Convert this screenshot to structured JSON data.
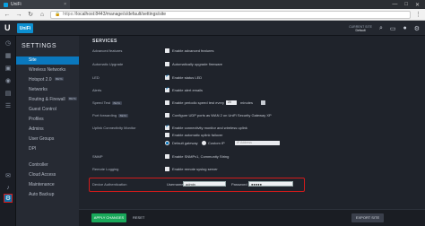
{
  "browser": {
    "tab_title": "UniFi",
    "tab_close": "×",
    "window_buttons": [
      "—",
      "□",
      "✕"
    ],
    "url_prefix": "https://",
    "url": "localhost:8443/manage/s/default/settings/site",
    "nav_icons": [
      "back-icon",
      "forward-icon",
      "reload-icon",
      "home-icon"
    ]
  },
  "header": {
    "logo_text": "U",
    "brand_text": "UniFi",
    "right_items": [
      "CURRENT SITE",
      "Default"
    ],
    "icons": [
      "search-icon",
      "chat-icon",
      "user-icon",
      "gear-icon"
    ]
  },
  "settings_nav": {
    "title": "SETTINGS",
    "items": [
      {
        "label": "Site",
        "active": true
      },
      {
        "label": "Wireless Networks",
        "active": false
      },
      {
        "label": "Hotspot 2.0",
        "beta": "BETA",
        "active": false
      },
      {
        "label": "Networks",
        "active": false
      },
      {
        "label": "Routing & Firewall",
        "beta": "BETA",
        "active": false
      },
      {
        "label": "Guest Control",
        "active": false
      },
      {
        "label": "Profiles",
        "active": false
      },
      {
        "label": "Admins",
        "active": false
      },
      {
        "label": "User Groups",
        "active": false
      },
      {
        "label": "DPI",
        "active": false
      },
      {
        "label": "Controller",
        "active": false
      },
      {
        "label": "Cloud Access",
        "active": false
      },
      {
        "label": "Maintenance",
        "active": false
      },
      {
        "label": "Auto Backup",
        "active": false
      }
    ]
  },
  "main": {
    "section_title": "SERVICES",
    "rows": [
      {
        "label": "Advanced features",
        "options": [
          {
            "text": "Enable advanced features",
            "checked": false
          }
        ]
      },
      {
        "label": "Automatic Upgrade",
        "options": [
          {
            "text": "Automatically upgrade firmware",
            "checked": false
          }
        ]
      },
      {
        "label": "LED",
        "options": [
          {
            "text": "Enable status LED",
            "checked": true
          }
        ]
      },
      {
        "label": "Alerts",
        "options": [
          {
            "text": "Enable alert emails",
            "checked": true
          }
        ]
      },
      {
        "label": "Speed Test",
        "tag": "BETA",
        "options": [
          {
            "text": "Enable periodic speed test every",
            "checked": false
          }
        ],
        "interval": "20",
        "interval_unit": "minutes"
      },
      {
        "label": "Port forwarding",
        "tag": "BETA",
        "options": [
          {
            "text": "Configure UDP ports as WAN 2 on UniFi Security Gateway XP",
            "checked": false
          }
        ]
      },
      {
        "label": "Uplink Connectivity Monitor",
        "options": [
          {
            "text": "Enable connectivity monitor and wireless uplink",
            "checked": true
          },
          {
            "text": "Enable automatic uplink failover",
            "checked": false
          }
        ]
      },
      {
        "label": "",
        "radio": [
          {
            "text": "Default gateway",
            "selected": true
          },
          {
            "text": "Custom IP",
            "selected": false
          }
        ],
        "ip_placeholder": "IP Address"
      },
      {
        "label": "SNMP",
        "options": [
          {
            "text": "Enable SNMPv1, Community String",
            "checked": false
          }
        ]
      },
      {
        "label": "Remote Logging",
        "options": [
          {
            "text": "Enable remote syslog server",
            "checked": false
          }
        ]
      }
    ],
    "device_auth": {
      "label": "Device Authentication",
      "username_label": "Username",
      "username_value": "admin",
      "password_label": "Password",
      "password_value": "●●●●●"
    }
  },
  "bottom": {
    "apply_label": "APPLY CHANGES",
    "reset_label": "RESET",
    "export_label": "EXPORT SITE"
  }
}
